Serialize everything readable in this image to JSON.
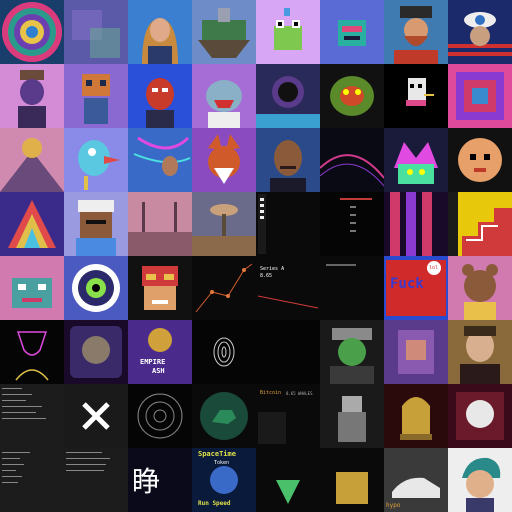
{
  "gallery": {
    "t_ser_title": "Series A",
    "t_ser_value": "8.65",
    "t_btc_title": "Bitcoin",
    "t_btc_value": "8.65 WHALES",
    "t_empire": "EMPIRE",
    "t_ash": "ASH",
    "t_space_top": "SpaceTime",
    "t_space_sub": "Token",
    "t_space_bottom": "Run Speed",
    "t_kanji": "睁",
    "t_fuck": "Fuck",
    "t_lol": "lol",
    "t_hypo": "hypo"
  }
}
